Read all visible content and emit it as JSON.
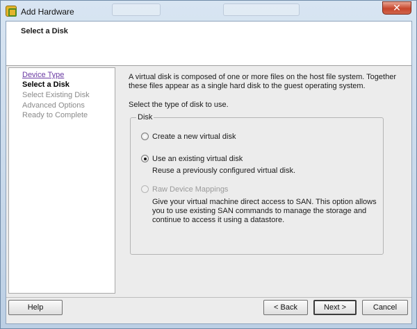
{
  "window": {
    "title": "Add Hardware",
    "close_label": "✕"
  },
  "header": {
    "title": "Select a Disk"
  },
  "nav": {
    "items": [
      {
        "label": "Device Type",
        "state": "link"
      },
      {
        "label": "Select a Disk",
        "state": "current"
      },
      {
        "label": "Select Existing Disk",
        "state": "pending"
      },
      {
        "label": "Advanced Options",
        "state": "pending"
      },
      {
        "label": "Ready to Complete",
        "state": "pending"
      }
    ]
  },
  "content": {
    "intro": "A virtual disk is composed of one or more files on the host file system. Together these files appear as a single hard disk to the guest operating system.",
    "prompt": "Select the type of disk to use."
  },
  "disk_group": {
    "legend": "Disk",
    "options": [
      {
        "label": "Create a new virtual disk",
        "checked": false,
        "enabled": true,
        "description": ""
      },
      {
        "label": "Use an existing virtual disk",
        "checked": true,
        "enabled": true,
        "description": "Reuse a previously configured virtual disk."
      },
      {
        "label": "Raw Device Mappings",
        "checked": false,
        "enabled": false,
        "description": "Give your virtual machine direct access to SAN. This option allows you to use existing SAN commands to manage the storage and continue to access it using a datastore."
      }
    ]
  },
  "buttons": {
    "help": "Help",
    "back": "< Back",
    "next": "Next >",
    "cancel": "Cancel"
  }
}
